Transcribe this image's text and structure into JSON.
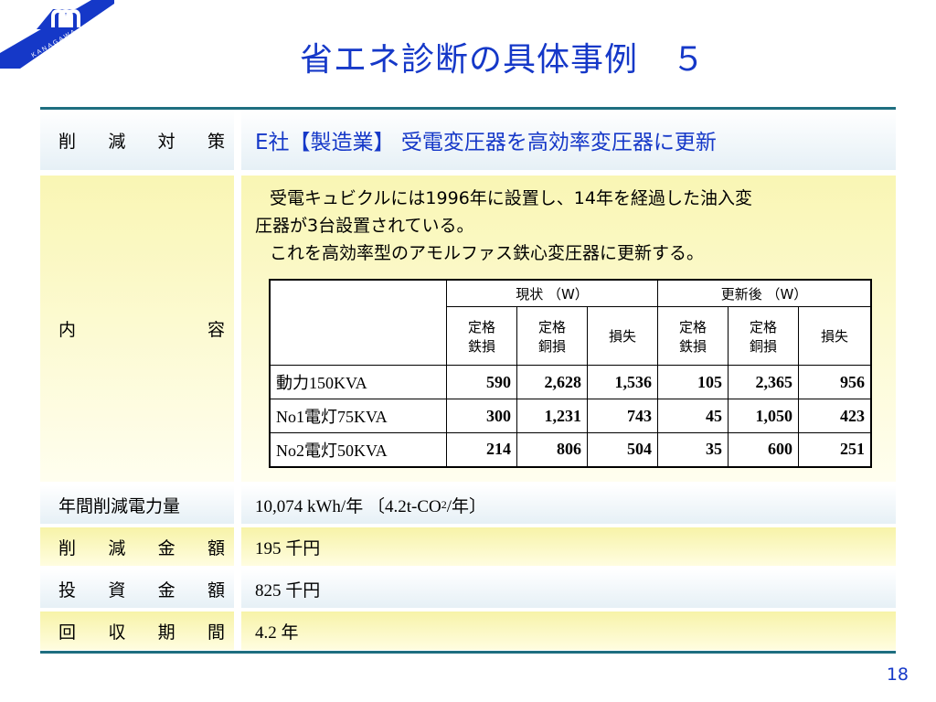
{
  "logo": {
    "text": "KANAGAWA",
    "colors": {
      "band": "#1538c8"
    }
  },
  "title": "省エネ診断の具体事例　５",
  "rows": {
    "target": {
      "label_chars": [
        "削",
        "減",
        "対",
        "策"
      ],
      "value": "E社【製造業】 受電変圧器を高効率変圧器に更新"
    },
    "content": {
      "label_chars": [
        "内",
        "容"
      ],
      "line1": "受電キュビクルには1996年に設置し、14年を経過した油入変",
      "line2": "圧器が3台設置されている。",
      "line3": "これを高効率型のアモルファス鉄心変圧器に更新する。"
    },
    "annual": {
      "label": "年間削減電力量",
      "value_main": "10,074 kWh/年 〔4.2t-CO",
      "value_sub": "2",
      "value_tail": "/年〕"
    },
    "saving": {
      "label_chars": [
        "削",
        "減",
        "金",
        "額"
      ],
      "value": "195 千円"
    },
    "invest": {
      "label_chars": [
        "投",
        "資",
        "金",
        "額"
      ],
      "value": "825 千円"
    },
    "payback": {
      "label_chars": [
        "回",
        "収",
        "期",
        "間"
      ],
      "value": "4.2 年"
    }
  },
  "inner_table": {
    "group_headers": [
      "現状 （W）",
      "更新後 （W）"
    ],
    "sub_headers": [
      {
        "l1": "定格",
        "l2": "鉄損"
      },
      {
        "l1": "定格",
        "l2": "銅損"
      },
      {
        "l1": "損失",
        "l2": ""
      },
      {
        "l1": "定格",
        "l2": "鉄損"
      },
      {
        "l1": "定格",
        "l2": "銅損"
      },
      {
        "l1": "損失",
        "l2": ""
      }
    ],
    "rows": [
      {
        "label": "動力150KVA",
        "values": [
          "590",
          "2,628",
          "1,536",
          "105",
          "2,365",
          "956"
        ]
      },
      {
        "label": "No1電灯75KVA",
        "values": [
          "300",
          "1,231",
          "743",
          "45",
          "1,050",
          "423"
        ]
      },
      {
        "label": "No2電灯50KVA",
        "values": [
          "214",
          "806",
          "504",
          "35",
          "600",
          "251"
        ]
      }
    ]
  },
  "page_number": "18"
}
